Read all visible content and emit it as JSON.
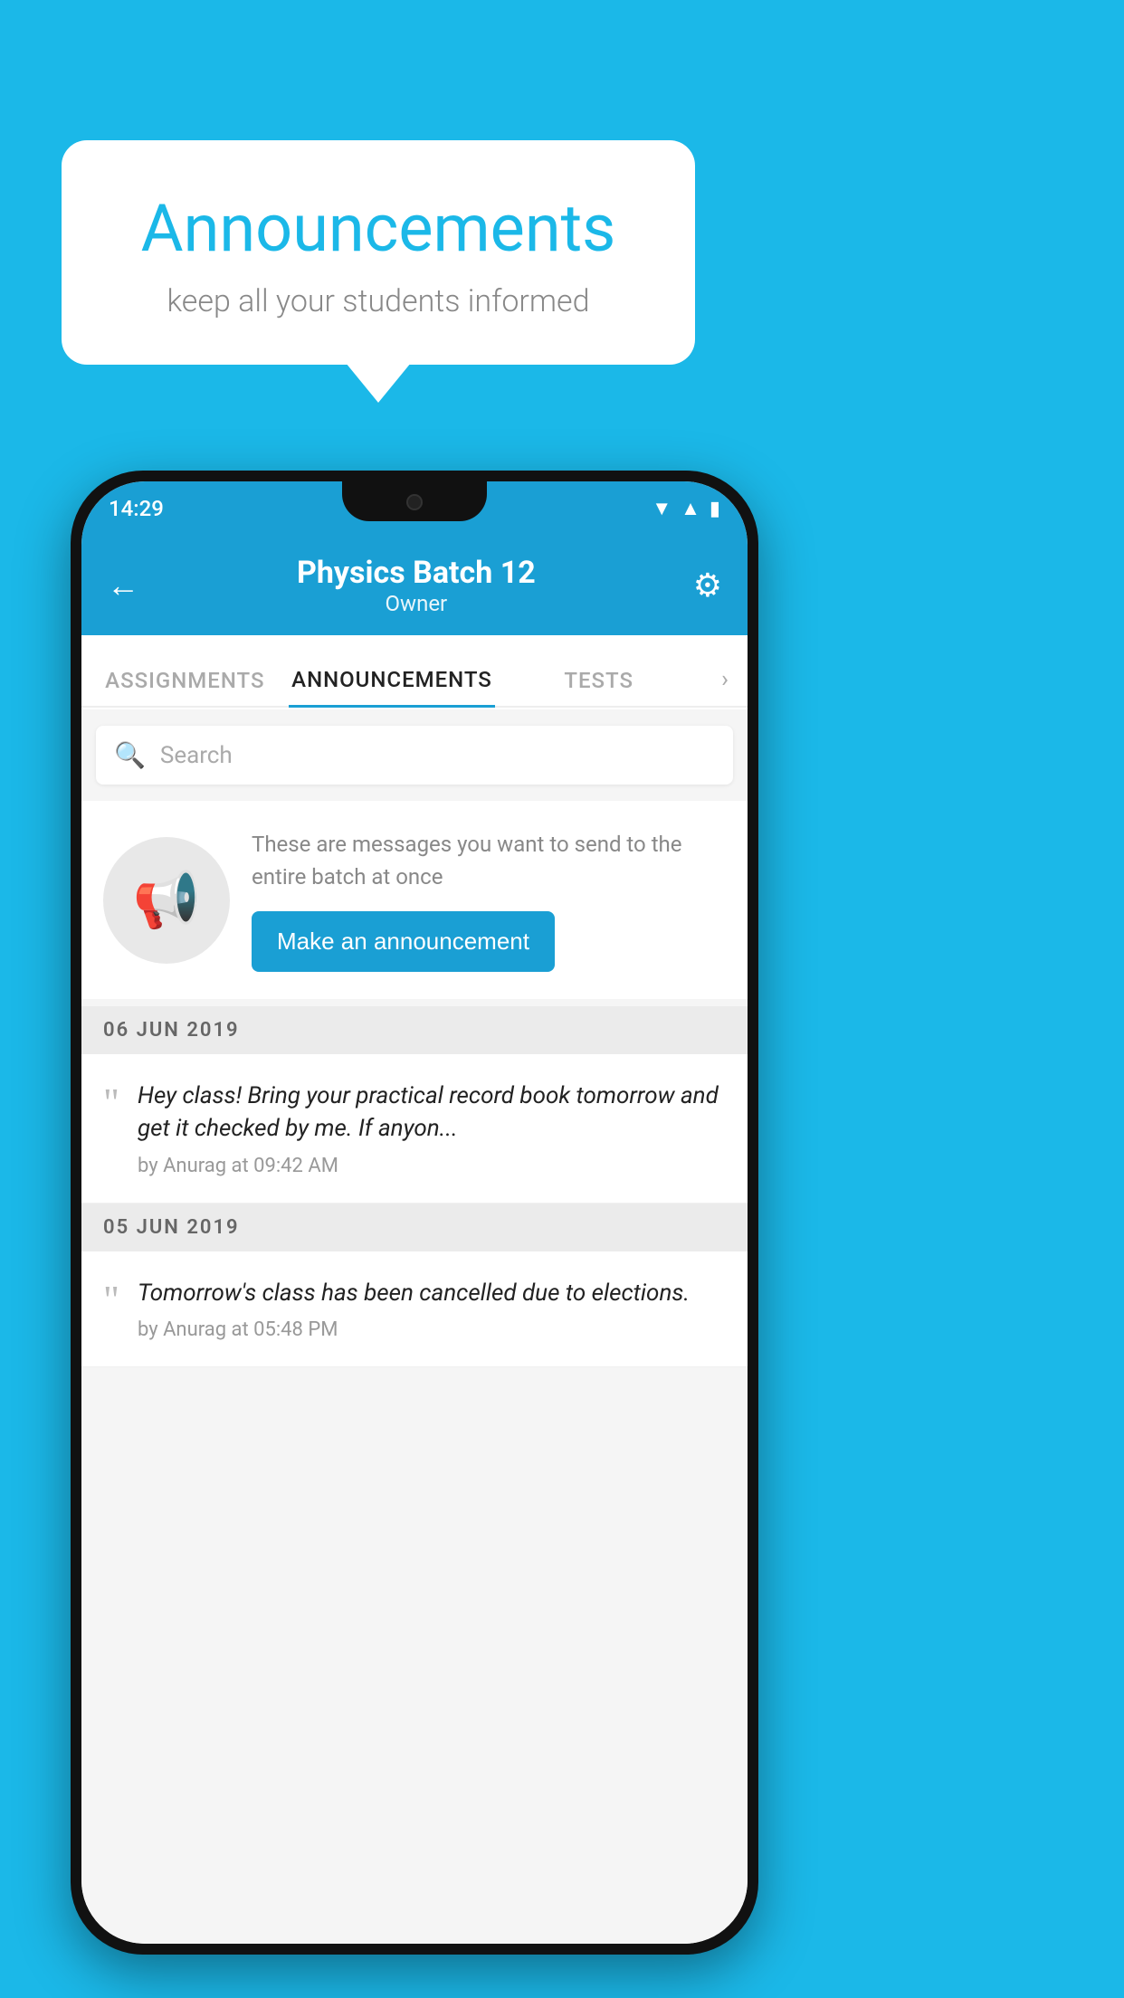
{
  "background_color": "#1BB8E8",
  "speech_bubble": {
    "title": "Announcements",
    "subtitle": "keep all your students informed"
  },
  "status_bar": {
    "time": "14:29",
    "icons": [
      "wifi",
      "signal",
      "battery"
    ]
  },
  "app_bar": {
    "back_label": "←",
    "title": "Physics Batch 12",
    "subtitle": "Owner",
    "settings_label": "⚙"
  },
  "tabs": [
    {
      "label": "ASSIGNMENTS",
      "active": false
    },
    {
      "label": "ANNOUNCEMENTS",
      "active": true
    },
    {
      "label": "TESTS",
      "active": false
    }
  ],
  "search": {
    "placeholder": "Search"
  },
  "promo": {
    "description": "These are messages you want to send to the entire batch at once",
    "button_label": "Make an announcement"
  },
  "announcements": [
    {
      "date": "06  JUN  2019",
      "message": "Hey class! Bring your practical record book tomorrow and get it checked by me. If anyon...",
      "meta": "by Anurag at 09:42 AM"
    },
    {
      "date": "05  JUN  2019",
      "message": "Tomorrow's class has been cancelled due to elections.",
      "meta": "by Anurag at 05:48 PM"
    }
  ]
}
